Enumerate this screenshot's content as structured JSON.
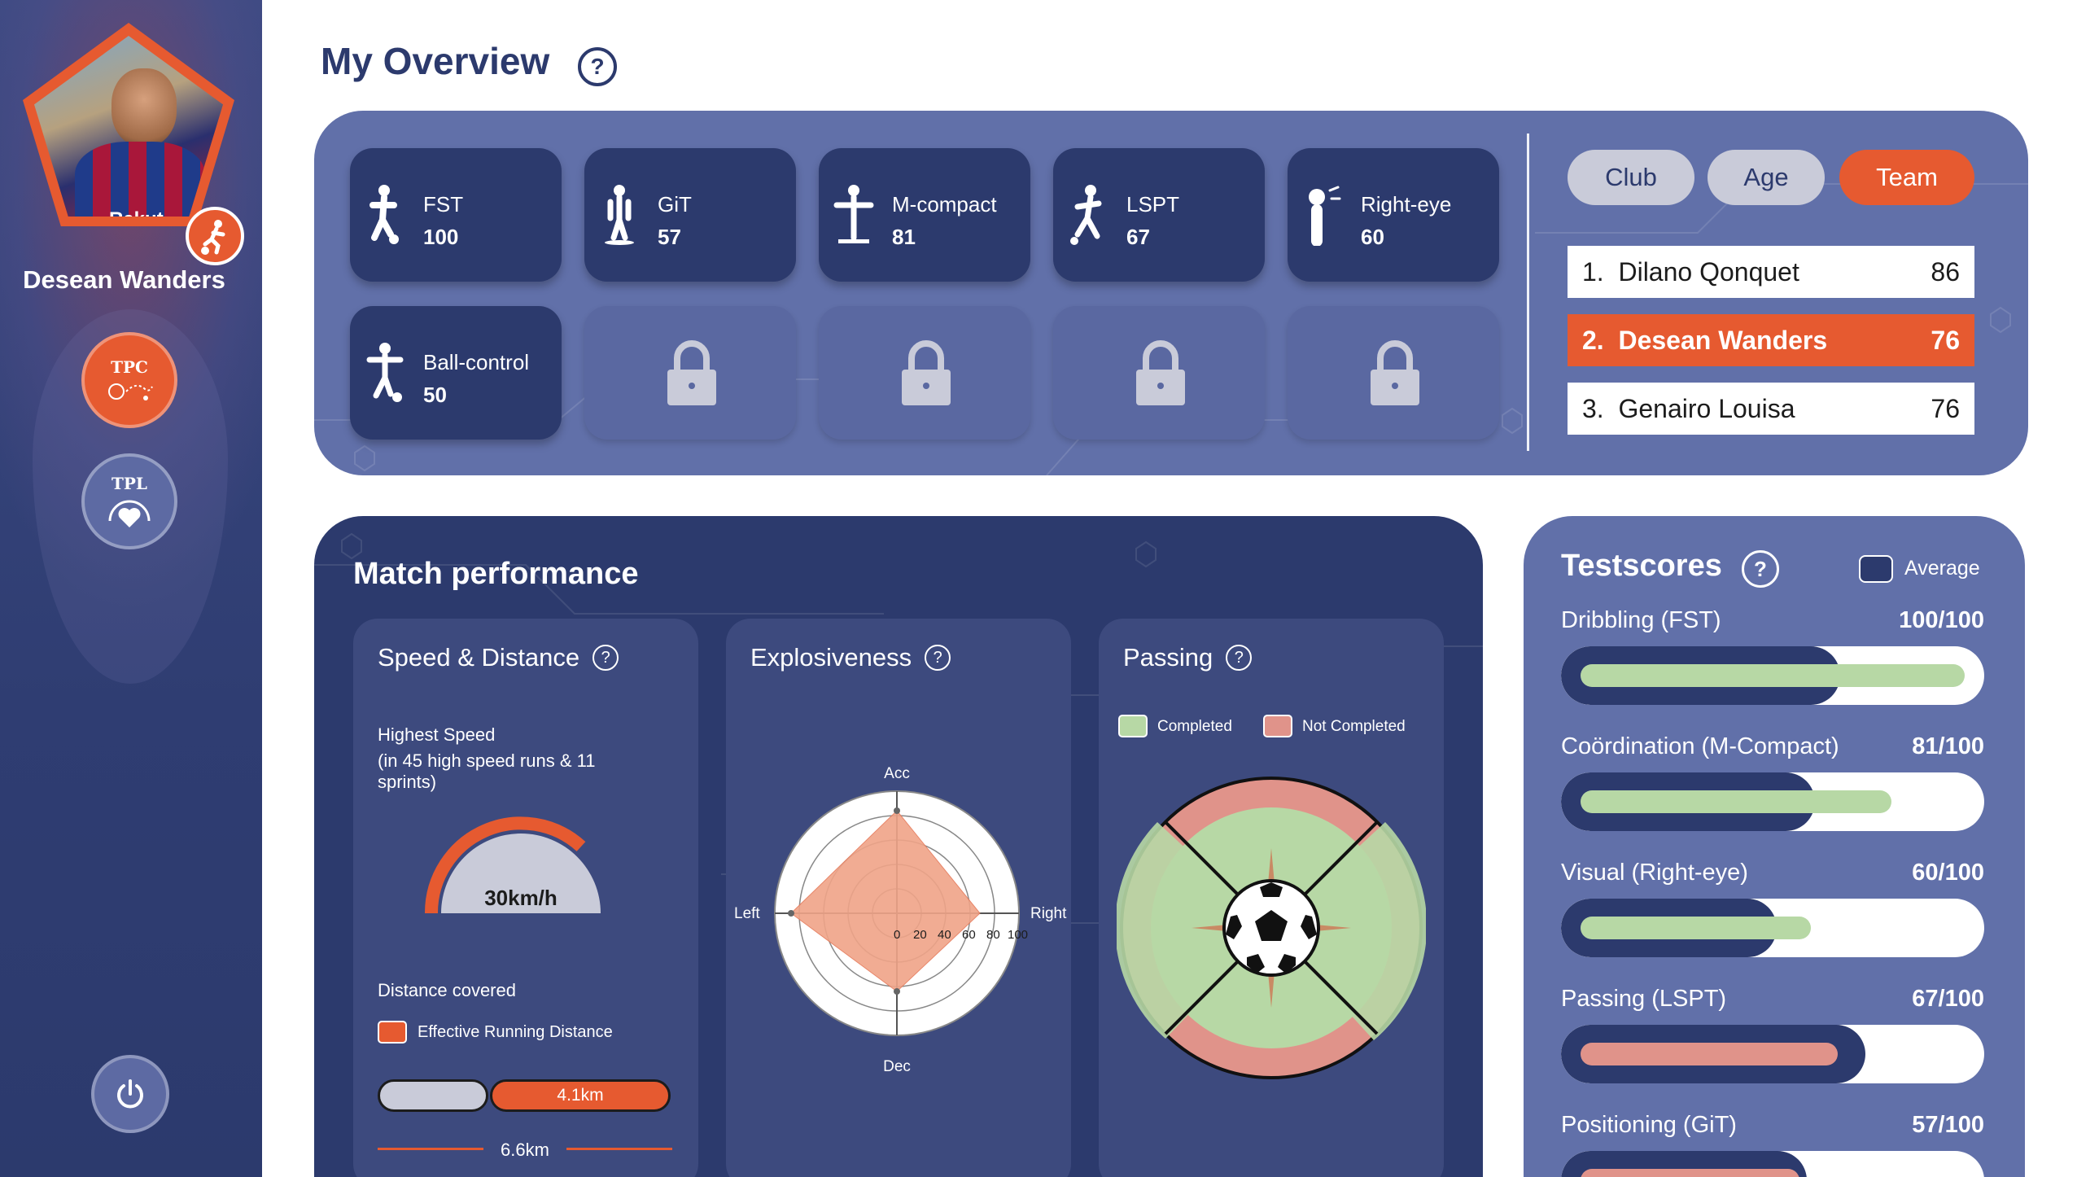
{
  "sidebar": {
    "player_name": "Desean Wanders",
    "sponsor": "Rakut",
    "buttons": [
      {
        "label": "TPC",
        "icon": "ball-dribble-icon"
      },
      {
        "label": "TPL",
        "icon": "heart-gauge-icon"
      }
    ],
    "power_icon": "power-icon"
  },
  "header": {
    "title": "My Overview",
    "help": "?"
  },
  "overview": {
    "tiles": [
      {
        "name": "FST",
        "value": "100",
        "icon": "player-ball-icon"
      },
      {
        "name": "GiT",
        "value": "57",
        "icon": "player-standing-icon"
      },
      {
        "name": "M-compact",
        "value": "81",
        "icon": "player-arms-out-icon"
      },
      {
        "name": "LSPT",
        "value": "67",
        "icon": "player-kick-icon"
      },
      {
        "name": "Right-eye",
        "value": "60",
        "icon": "player-eye-icon"
      },
      {
        "name": "Ball-control",
        "value": "50",
        "icon": "player-ball-control-icon"
      }
    ],
    "locked_count": 4,
    "filters": [
      "Club",
      "Age",
      "Team"
    ],
    "active_filter": "Team",
    "leaderboard": [
      {
        "rank": "1.",
        "name": "Dilano Qonquet",
        "score": "86"
      },
      {
        "rank": "2.",
        "name": "Desean Wanders",
        "score": "76"
      },
      {
        "rank": "3.",
        "name": "Genairo Louisa",
        "score": "76"
      }
    ]
  },
  "match": {
    "title": "Match performance",
    "speed": {
      "title": "Speed & Distance",
      "highest_label": "Highest Speed",
      "highest_sub": "(in 45 high speed runs & 11 sprints)",
      "gauge_value": "30km/h",
      "distance_label": "Distance covered",
      "legend": "Effective Running Distance",
      "effective": "4.1km",
      "total": "6.6km"
    },
    "explosiveness": {
      "title": "Explosiveness",
      "axes": {
        "top": "Acc",
        "bottom": "Dec",
        "left": "Left",
        "right": "Right"
      },
      "ticks": [
        "0",
        "20",
        "40",
        "60",
        "80",
        "100"
      ]
    },
    "passing": {
      "title": "Passing",
      "legend_completed": "Completed",
      "legend_not_completed": "Not Completed"
    }
  },
  "testscores": {
    "title": "Testscores",
    "average_label": "Average",
    "items": [
      {
        "name": "Dribbling (FST)",
        "score": "100/100",
        "value": 100,
        "avg": 66,
        "color": "#b7d8a5"
      },
      {
        "name": "Coördination (M-Compact)",
        "score": "81/100",
        "value": 81,
        "avg": 60,
        "color": "#b7d8a5"
      },
      {
        "name": "Visual (Right-eye)",
        "score": "60/100",
        "value": 60,
        "avg": 51,
        "color": "#b7d8a5"
      },
      {
        "name": "Passing (LSPT)",
        "score": "67/100",
        "value": 67,
        "avg": 72,
        "color": "#e0938a"
      },
      {
        "name": "Positioning (GiT)",
        "score": "57/100",
        "value": 57,
        "avg": 58,
        "color": "#e0938a"
      }
    ]
  },
  "colors": {
    "navy": "#2c3a6d",
    "accent": "#e65a30",
    "panel": "#6170a9",
    "green": "#b7d8a5",
    "red": "#e0938a"
  }
}
